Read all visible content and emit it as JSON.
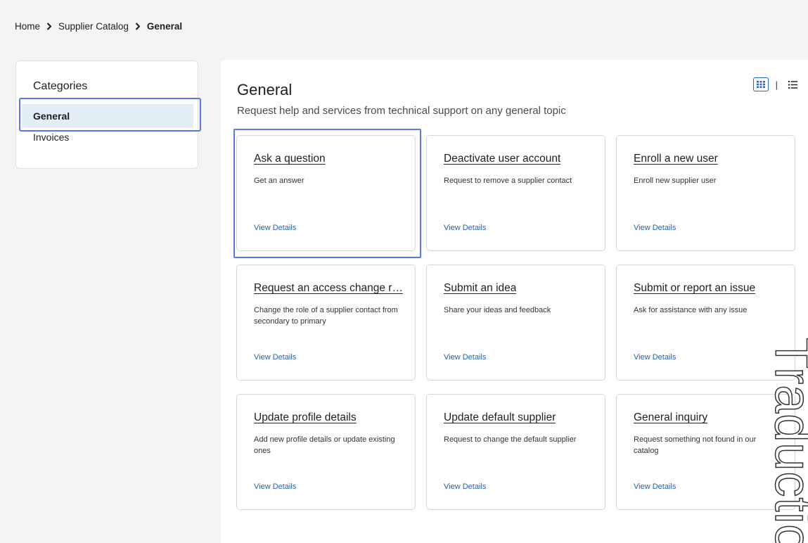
{
  "breadcrumb": {
    "home": "Home",
    "catalog": "Supplier Catalog",
    "current": "General"
  },
  "sidebar": {
    "title": "Categories",
    "items": [
      {
        "label": "General"
      },
      {
        "label": "Invoices"
      }
    ]
  },
  "main": {
    "title": "General",
    "description": "Request help and services from technical support on any general topic",
    "cards": [
      {
        "title": "Ask a question",
        "description": "Get an answer",
        "link": "View Details"
      },
      {
        "title": "Deactivate user account",
        "description": "Request to remove a supplier contact",
        "link": "View Details"
      },
      {
        "title": "Enroll a new user",
        "description": "Enroll new supplier user",
        "link": "View Details"
      },
      {
        "title": "Request an access change r…",
        "description": "Change the role of a supplier contact from secondary to primary",
        "link": "View Details"
      },
      {
        "title": "Submit an idea",
        "description": "Share your ideas and feedback",
        "link": "View Details"
      },
      {
        "title": "Submit or report an issue",
        "description": "Ask for assistance with any issue",
        "link": "View Details"
      },
      {
        "title": "Update profile details",
        "description": "Add new profile details or update existing ones",
        "link": "View Details"
      },
      {
        "title": "Update default supplier",
        "description": "Request to change the default supplier",
        "link": "View Details"
      },
      {
        "title": "General inquiry",
        "description": "Request something not found in our catalog",
        "link": "View Details"
      }
    ]
  },
  "view_toggle": {
    "divider": "|",
    "grid_icon": "grid-view-icon",
    "list_icon": "list-view-icon"
  },
  "watermark": {
    "text": "Traductio"
  },
  "colors": {
    "accent_link": "#2460b8",
    "focus_ring": "#5a77ee",
    "active_item_bg": "#e3eff5"
  }
}
